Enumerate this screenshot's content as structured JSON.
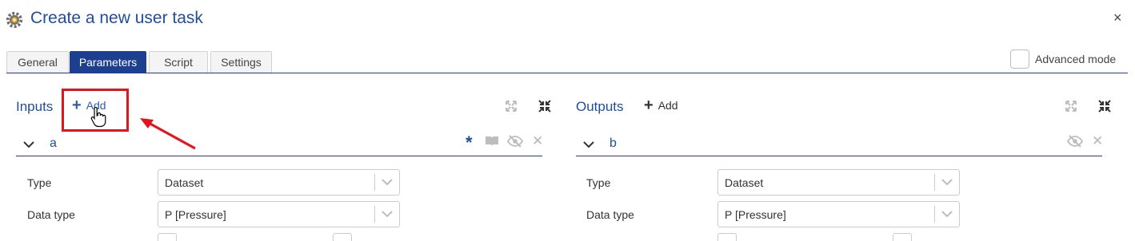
{
  "dialog": {
    "title": "Create a new user task",
    "close_glyph": "×"
  },
  "tabs": [
    {
      "label": "General",
      "active": false
    },
    {
      "label": "Parameters",
      "active": true
    },
    {
      "label": "Script",
      "active": false
    },
    {
      "label": "Settings",
      "active": false
    }
  ],
  "advanced_mode": {
    "label": "Advanced mode",
    "checked": false
  },
  "inputs": {
    "title": "Inputs",
    "add_label": "Add",
    "param": {
      "name": "a",
      "required_glyph": "*",
      "fields": [
        {
          "label": "Type",
          "value": "Dataset"
        },
        {
          "label": "Data type",
          "value": "P [Pressure]"
        }
      ]
    }
  },
  "outputs": {
    "title": "Outputs",
    "add_label": "Add",
    "param": {
      "name": "b",
      "fields": [
        {
          "label": "Type",
          "value": "Dataset"
        },
        {
          "label": "Data type",
          "value": "P [Pressure]"
        }
      ]
    }
  },
  "colors": {
    "accent": "#1d3f8f",
    "title": "#1f4e9a",
    "highlight": "#e4131c",
    "muted_icon": "#b7b7b7"
  },
  "icons": [
    "gear-icon",
    "close-icon",
    "plus-icon",
    "expand-icon",
    "collapse-icon",
    "chevron-down-icon",
    "asterisk-icon",
    "book-icon",
    "eye-off-icon",
    "remove-icon",
    "cursor-hand-icon",
    "arrow-annotation"
  ]
}
